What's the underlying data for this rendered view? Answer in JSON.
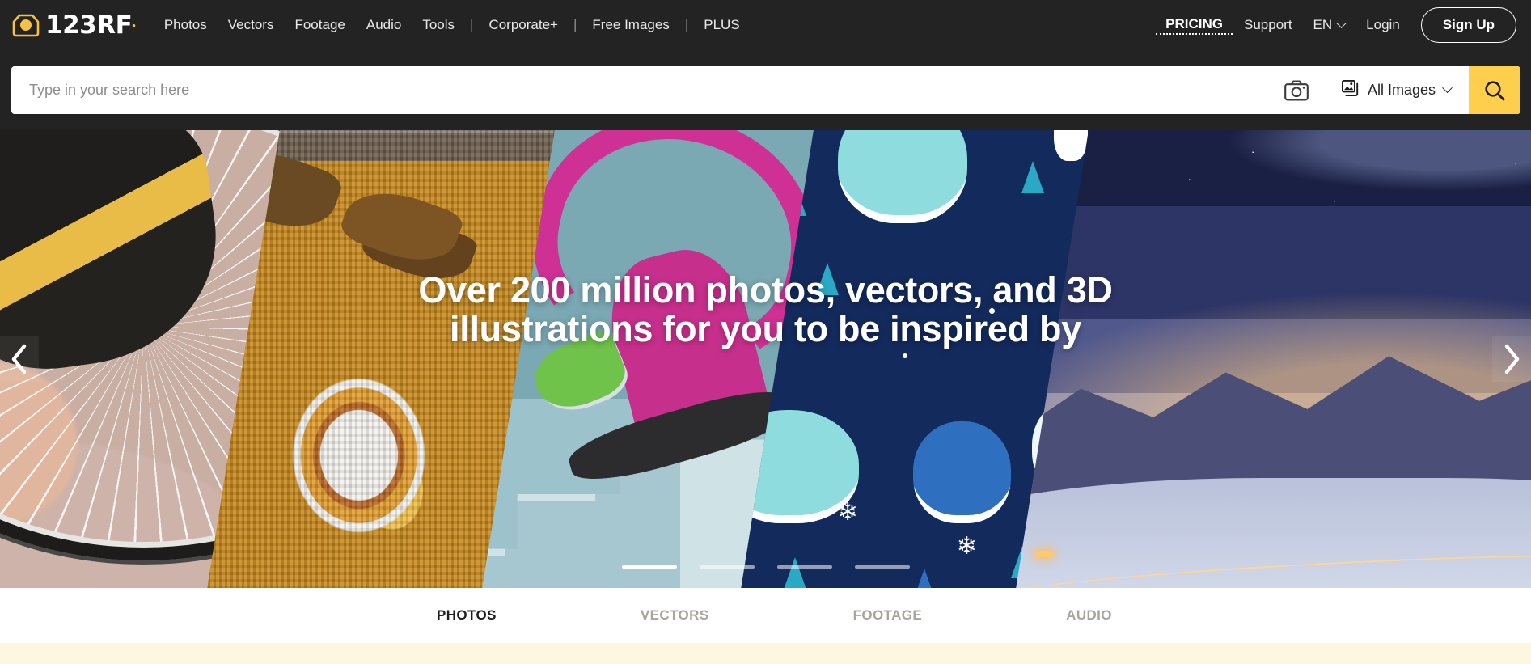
{
  "brand": {
    "name": "123RF",
    "logo_icon": "camera-logo-icon",
    "logo_accent": "#f5c243",
    "trademark": "•"
  },
  "nav": {
    "items": [
      {
        "label": "Photos",
        "type": "link"
      },
      {
        "label": "Vectors",
        "type": "link"
      },
      {
        "label": "Footage",
        "type": "link"
      },
      {
        "label": "Audio",
        "type": "link"
      },
      {
        "label": "Tools",
        "type": "link"
      },
      {
        "label": "|",
        "type": "separator"
      },
      {
        "label": "Corporate+",
        "type": "link"
      },
      {
        "label": "|",
        "type": "separator"
      },
      {
        "label": "Free Images",
        "type": "link"
      },
      {
        "label": "|",
        "type": "separator"
      },
      {
        "label": "PLUS",
        "type": "link"
      }
    ],
    "pricing": "PRICING",
    "support": "Support",
    "language": "EN",
    "language_icon": "chevron-down-icon",
    "login": "Login",
    "signup": "Sign Up"
  },
  "search": {
    "placeholder": "Type in your search here",
    "value": "",
    "camera_icon": "camera-search-icon",
    "filter_icon": "image-stack-icon",
    "filter_label": "All Images",
    "filter_chevron": "chevron-down-icon",
    "submit_icon": "search-icon",
    "submit_color": "#fdcf4d"
  },
  "hero": {
    "headline_line1": "Over 200 million photos, vectors, and 3D",
    "headline_line2": "illustrations for you to be inspired by",
    "prev_icon": "chevron-left-icon",
    "next_icon": "chevron-right-icon",
    "slides_total": 4,
    "active_slide": 1,
    "panels": [
      {
        "name": "wheelchair-wheel-photo"
      },
      {
        "name": "yellow-sweater-tea-photo"
      },
      {
        "name": "3d-skateboard-illustration"
      },
      {
        "name": "winter-yeti-vector-pattern"
      },
      {
        "name": "snow-mountain-night-photo"
      }
    ]
  },
  "tabs": {
    "items": [
      {
        "label": "PHOTOS",
        "active": true
      },
      {
        "label": "VECTORS",
        "active": false
      },
      {
        "label": "FOOTAGE",
        "active": false
      },
      {
        "label": "AUDIO",
        "active": false
      }
    ]
  }
}
